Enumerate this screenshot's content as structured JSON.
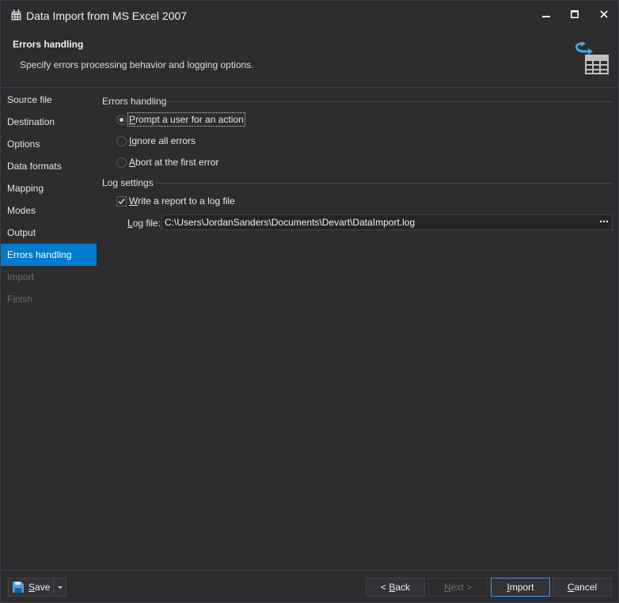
{
  "window": {
    "title": "Data Import from MS Excel 2007",
    "controls": {
      "minimize": "—",
      "maximize": "☐",
      "close": "✕"
    }
  },
  "header": {
    "title": "Errors handling",
    "description": "Specify errors processing behavior and logging options.",
    "icon": "import-table-icon"
  },
  "sidebar": {
    "items": [
      {
        "label": "Source file",
        "state": "normal"
      },
      {
        "label": "Destination",
        "state": "normal"
      },
      {
        "label": "Options",
        "state": "normal"
      },
      {
        "label": "Data formats",
        "state": "normal"
      },
      {
        "label": "Mapping",
        "state": "normal"
      },
      {
        "label": "Modes",
        "state": "normal"
      },
      {
        "label": "Output",
        "state": "normal"
      },
      {
        "label": "Errors handling",
        "state": "active"
      },
      {
        "label": "Import",
        "state": "disabled"
      },
      {
        "label": "Finish",
        "state": "disabled"
      }
    ]
  },
  "errors_handling": {
    "group_label": "Errors handling",
    "options": [
      {
        "mnemonic": "P",
        "rest": "rompt a user for an action",
        "checked": true
      },
      {
        "mnemonic": "I",
        "rest": "gnore all errors",
        "checked": false
      },
      {
        "mnemonic": "A",
        "rest": "bort at the first error",
        "checked": false
      }
    ]
  },
  "log_settings": {
    "group_label": "Log settings",
    "write_report": {
      "mnemonic": "W",
      "rest": "rite a report to a log file",
      "checked": true
    },
    "log_file": {
      "label_mnemonic": "L",
      "label_rest": "og file:",
      "value": "C:\\Users\\JordanSanders\\Documents\\Devart\\DataImport.log",
      "browse_label": "⋯"
    }
  },
  "footer": {
    "save": {
      "mnemonic": "S",
      "rest": "ave"
    },
    "back": {
      "prefix": "< ",
      "mnemonic": "B",
      "rest": "ack"
    },
    "next": {
      "mnemonic": "N",
      "rest": "ext >"
    },
    "import": {
      "mnemonic": "I",
      "rest": "mport"
    },
    "cancel": {
      "mnemonic": "C",
      "rest": "ancel"
    }
  },
  "colors": {
    "accent": "#007acc",
    "background": "#2d2d30",
    "icon_blue": "#4aa3e8"
  }
}
